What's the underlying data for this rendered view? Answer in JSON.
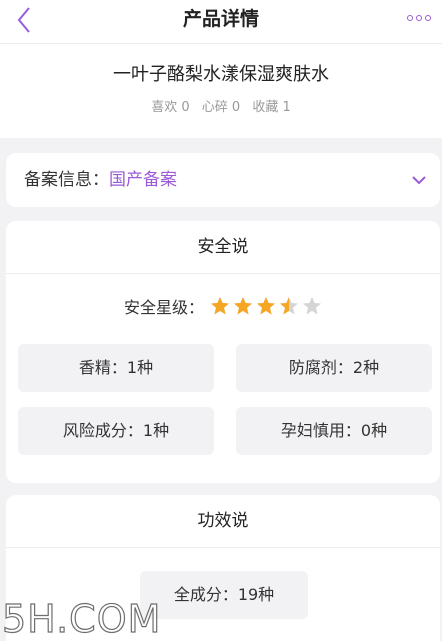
{
  "header": {
    "title": "产品详情"
  },
  "product": {
    "name": "一叶子酪梨水漾保湿爽肤水",
    "stats": [
      "喜欢 0",
      "心碎 0",
      "收藏 1"
    ]
  },
  "filing": {
    "label": "备案信息：",
    "value": "国产备案"
  },
  "safety": {
    "title": "安全说",
    "rating_label": "安全星级：",
    "rating_value": 3.5,
    "rating_max": 5,
    "chips": [
      "香精：1种",
      "防腐剂：2种",
      "风险成分：1种",
      "孕妇慎用：0种"
    ]
  },
  "efficacy": {
    "title": "功效说",
    "total": "全成分：19种"
  },
  "watermark": "5H.COM",
  "colors": {
    "accent": "#9b5bd6",
    "star": "#f5a623",
    "star_empty": "#d5d5d5"
  }
}
